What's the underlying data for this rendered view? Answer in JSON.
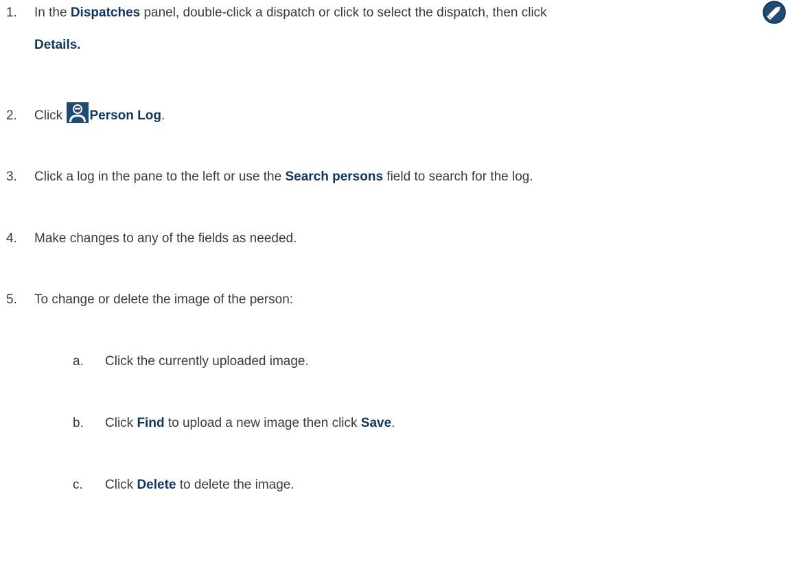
{
  "steps": [
    {
      "num": "1.",
      "parts": [
        "In the ",
        "Dispatches",
        " panel, double-click a dispatch or click to select the dispatch, then click"
      ],
      "continuation": "Details.",
      "icon": "pencil-edit-icon"
    },
    {
      "num": "2.",
      "parts": [
        "Click ",
        "Person Log",
        "."
      ],
      "icon": "person-log-icon"
    },
    {
      "num": "3.",
      "parts": [
        "Click a log in the pane to the left or use the ",
        "Search persons",
        " field to search for the log."
      ]
    },
    {
      "num": "4.",
      "parts": [
        "Make changes to any of the fields as needed."
      ]
    },
    {
      "num": "5.",
      "parts": [
        "To change or delete the image of the person:"
      ]
    }
  ],
  "substeps": [
    {
      "num": "a.",
      "parts": [
        "Click the currently uploaded image."
      ]
    },
    {
      "num": "b.",
      "parts": [
        "Click ",
        "Find",
        " to upload a new image then click ",
        "Save",
        "."
      ]
    },
    {
      "num": "c.",
      "parts": [
        "Click ",
        "Delete",
        " to delete the image."
      ]
    }
  ],
  "colors": {
    "text": "#3a3a3a",
    "ui_term": "#10365d",
    "icon_dark": "#1f4a73"
  }
}
